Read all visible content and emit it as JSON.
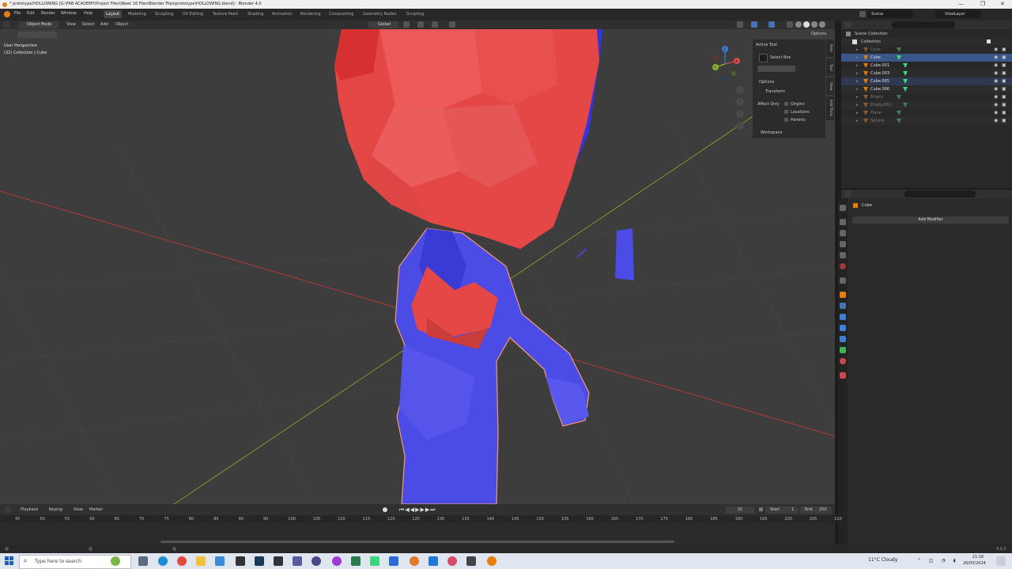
{
  "window": {
    "title": "* prototype/HOLLOWING [G:\\FAB ACADEMY\\Project Files\\Week 16 Files\\Blender Files\\prototype\\HOLLOWING.blend] - Blender 4.0",
    "controls": [
      "—",
      "❐",
      "✕"
    ]
  },
  "menu": {
    "items": [
      "File",
      "Edit",
      "Render",
      "Window",
      "Help"
    ],
    "workspaces": [
      "Layout",
      "Modeling",
      "Sculpting",
      "UV Editing",
      "Texture Paint",
      "Shading",
      "Animation",
      "Rendering",
      "Compositing",
      "Geometry Nodes",
      "Scripting"
    ],
    "active_workspace": "Layout",
    "scene": "Scene",
    "view_layer": "ViewLayer"
  },
  "viewport_header": {
    "mode": "Object Mode",
    "menus": [
      "View",
      "Select",
      "Add",
      "Object"
    ],
    "transform_orientation": "Global",
    "options": "Options"
  },
  "viewport": {
    "perspective": "User Perspective",
    "collection_info": "(32) Collection | Cube",
    "gizmo_axes": [
      "X",
      "Y",
      "Z"
    ]
  },
  "npanel": {
    "active_tool": "Active Tool",
    "tool_name": "Select Box",
    "options": "Options",
    "transform": "Transform",
    "affect_only": "Affect Only",
    "checkboxes": [
      "Origins",
      "Locations",
      "Parents"
    ],
    "workspace": "Workspace",
    "tabs": [
      "Item",
      "Tool",
      "View",
      "Add Tools"
    ]
  },
  "outliner": {
    "scene_collection": "Scene Collection",
    "collection": "Collection",
    "objects": [
      {
        "name": "Cone",
        "state": "dim"
      },
      {
        "name": "Cube",
        "state": "selected"
      },
      {
        "name": "Cube.001",
        "state": "normal"
      },
      {
        "name": "Cube.003",
        "state": "normal"
      },
      {
        "name": "Cube.005",
        "state": "highlight"
      },
      {
        "name": "Cube.006",
        "state": "normal"
      },
      {
        "name": "Empty",
        "state": "dim"
      },
      {
        "name": "Empty.001",
        "state": "dim"
      },
      {
        "name": "Plane",
        "state": "dim"
      },
      {
        "name": "Sphere",
        "state": "dim"
      }
    ]
  },
  "properties": {
    "object_name": "Cube",
    "add_modifier": "Add Modifier"
  },
  "timeline": {
    "menus": [
      "Playback",
      "Keying",
      "View",
      "Marker"
    ],
    "current_frame": "32",
    "start_label": "Start",
    "start": "1",
    "end_label": "End",
    "end": "250",
    "frame_labels": [
      "45",
      "50",
      "55",
      "60",
      "65",
      "70",
      "75",
      "80",
      "85",
      "90",
      "95",
      "100",
      "105",
      "110",
      "115",
      "120",
      "125",
      "130",
      "135",
      "140",
      "145",
      "150",
      "155",
      "160",
      "165",
      "170",
      "175",
      "180",
      "185",
      "190",
      "195",
      "200",
      "205",
      "210"
    ]
  },
  "statusbar": {
    "version": "4.0.2"
  },
  "taskbar": {
    "search_placeholder": "Type here to search",
    "weather": "11°C  Cloudy",
    "time": "21:16",
    "date": "26/05/2024"
  },
  "colors": {
    "head_red": "#e54747",
    "body_blue": "#4b4be6",
    "accent_blue": "#4772b3",
    "x_axis": "#d94b4b",
    "y_axis": "#8bb22e",
    "z_axis": "#3f7fd6"
  }
}
